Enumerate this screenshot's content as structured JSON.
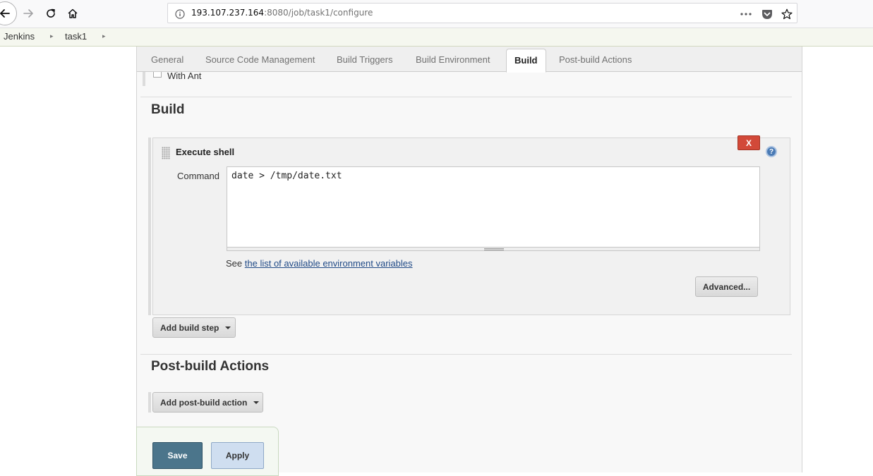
{
  "browser": {
    "url_host": "193.107.237.164",
    "url_path": ":8080/job/task1/configure"
  },
  "breadcrumb": {
    "items": [
      {
        "label": "Jenkins"
      },
      {
        "label": "task1"
      }
    ]
  },
  "tabs": [
    {
      "label": "General",
      "active": false
    },
    {
      "label": "Source Code Management",
      "active": false
    },
    {
      "label": "Build Triggers",
      "active": false
    },
    {
      "label": "Build Environment",
      "active": false
    },
    {
      "label": "Build",
      "active": true
    },
    {
      "label": "Post-build Actions",
      "active": false
    }
  ],
  "with_ant": {
    "label": "With Ant",
    "checked": false
  },
  "build": {
    "title": "Build",
    "step": {
      "title": "Execute shell",
      "delete_label": "X",
      "command_label": "Command",
      "command_value": "date > /tmp/date.txt",
      "env_prefix": "See",
      "env_link": "the list of available environment variables",
      "advanced_label": "Advanced..."
    },
    "add_step_label": "Add build step"
  },
  "post_build": {
    "title": "Post-build Actions",
    "add_action_label": "Add post-build action"
  },
  "footer": {
    "save_label": "Save",
    "apply_label": "Apply"
  },
  "help_glyph": "?",
  "icons": [
    "back-arrow-icon",
    "forward-arrow-icon",
    "reload-icon",
    "home-icon",
    "info-icon",
    "more-icon",
    "pocket-icon",
    "star-icon",
    "help-icon",
    "drag-handle-icon",
    "caret-down-icon"
  ],
  "colors": {
    "jenkins_breadcrumb_bg": "#f5f7ef",
    "delete_red": "#d24939",
    "save_blue": "#4b758b",
    "apply_blue": "#cfdef0",
    "link": "#204a87"
  }
}
